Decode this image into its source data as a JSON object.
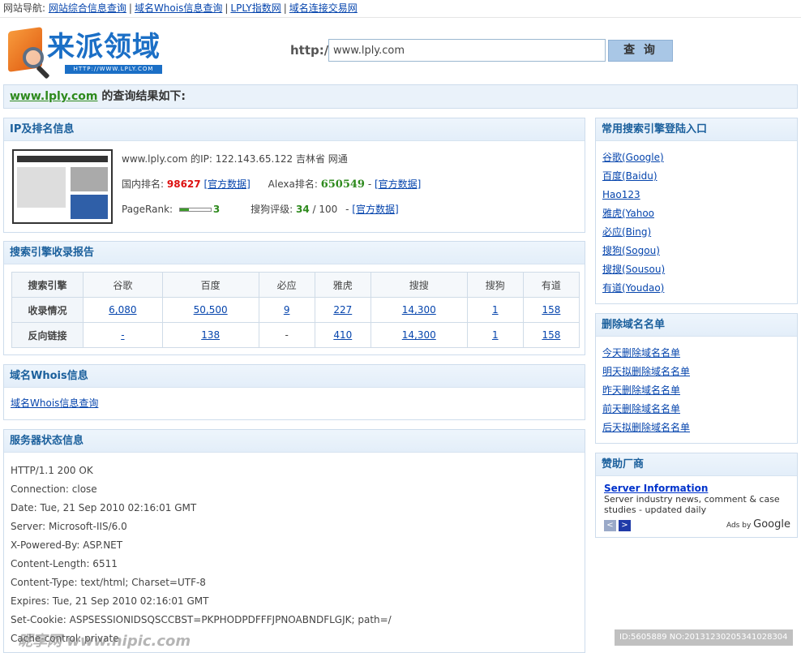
{
  "topnav": {
    "label": "网站导航:",
    "links": [
      "网站综合信息查询",
      "域名Whois信息查询",
      "LPLY指数网",
      "域名连接交易网"
    ]
  },
  "logo": {
    "text": "来派领域",
    "url": "HTTP://WWW.LPLY.COM"
  },
  "search": {
    "prefix": "http://",
    "value": "www.lply.com",
    "button": "查 询"
  },
  "result": {
    "domain": "www.lply.com",
    "suffix": " 的查询结果如下:"
  },
  "ip_panel": {
    "title": "IP及排名信息",
    "ip_label": "www.lply.com 的IP:",
    "ip_value": "122.143.65.122 吉林省 网通",
    "cn_rank_label": "国内排名:",
    "cn_rank": "98627",
    "official": "[官方数据]",
    "alexa_label": "Alexa排名:",
    "alexa_rank": "650549",
    "pr_label": "PageRank:",
    "pr_value": "3",
    "pr_fraction": 0.3,
    "sogou_label": "搜狗评级:",
    "sogou_value": "34",
    "sogou_max": "/ 100",
    "dash": "-"
  },
  "se_panel": {
    "title": "搜索引擎收录报告",
    "header": [
      "搜索引擎",
      "谷歌",
      "百度",
      "必应",
      "雅虎",
      "搜搜",
      "搜狗",
      "有道"
    ],
    "rows": [
      {
        "label": "收录情况",
        "cells": [
          "6,080",
          "50,500",
          "9",
          "227",
          "14,300",
          "1",
          "158"
        ]
      },
      {
        "label": "反向链接",
        "cells": [
          "-",
          "138",
          "-",
          "410",
          "14,300",
          "1",
          "158"
        ]
      }
    ]
  },
  "whois_panel": {
    "title": "域名Whois信息",
    "link": "域名Whois信息查询"
  },
  "server_panel": {
    "title": "服务器状态信息",
    "lines": [
      "HTTP/1.1 200 OK",
      "Connection: close",
      "Date: Tue, 21 Sep 2010 02:16:01 GMT",
      "Server: Microsoft-IIS/6.0",
      "X-Powered-By: ASP.NET",
      "Content-Length: 6511",
      "Content-Type: text/html; Charset=UTF-8",
      "Expires: Tue, 21 Sep 2010 02:16:01 GMT",
      "Set-Cookie: ASPSESSIONIDSQSCCBST=PKPHODPDFFFJPNOABNDFLGJK; path=/",
      "Cache-control: private"
    ]
  },
  "engines_panel": {
    "title": "常用搜索引擎登陆入口",
    "links": [
      "谷歌(Google)",
      "百度(Baidu)",
      "Hao123",
      "雅虎(Yahoo",
      "必应(Bing)",
      "搜狗(Sogou)",
      "搜搜(Sousou)",
      "有道(Youdao)"
    ]
  },
  "delete_panel": {
    "title": "删除域名名单",
    "links": [
      "今天删除域名名单",
      "明天拟删除域名名单",
      "昨天删除域名名单",
      "前天删除域名名单",
      "后天拟删除域名名单"
    ]
  },
  "ads_panel": {
    "title": "赞助厂商",
    "ad_title": "Server Information",
    "ad_desc": "Server industry news, comment & case studies - updated daily",
    "prev": "<",
    "next": ">",
    "ads_by": "Ads by",
    "google": "Google"
  },
  "watermark": {
    "left": "昵享网 www.nipic.com",
    "right": "ID:5605889 NO:20131230205341028304"
  }
}
